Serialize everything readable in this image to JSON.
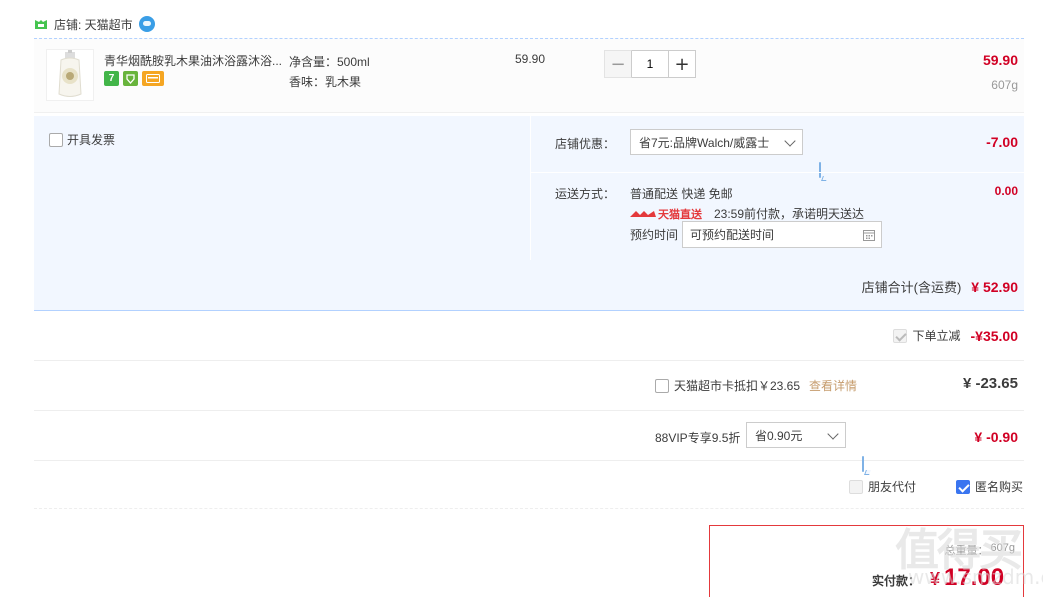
{
  "shop": {
    "label": "店铺: 天猫超市",
    "icon": "tmall-shop-icon"
  },
  "item": {
    "title": "青华烟酰胺乳木果油沐浴露沐浴...",
    "badges": [
      {
        "icon": "seven-day-return-icon",
        "text": "7",
        "color": "#4cb04c"
      },
      {
        "icon": "tmall-guarantee-icon",
        "text": "",
        "color": "#64b23c"
      },
      {
        "icon": "credit-card-icon",
        "text": "",
        "color": "#f5a623"
      }
    ],
    "sku_line1": "净含量：500ml",
    "sku_line2": "香味：乳木果",
    "unit_price": "59.90",
    "quantity": "1",
    "subtotal": "59.90",
    "weight": "607g"
  },
  "options": {
    "invoice_label": "开具发票",
    "shop_discount_label": "店铺优惠：",
    "shop_discount_select": "省7元:品牌Walch/威露士",
    "shop_discount_amount": "-7.00",
    "shipping_label": "运送方式：",
    "shipping_method": "普通配送 快递 免邮",
    "shipping_fee": "0.00",
    "tmall_direct": "天猫直送",
    "delivery_promise": "23:59前付款，承诺明天送达",
    "appointment_label": "预约时间",
    "appointment_placeholder": "可预约配送时间"
  },
  "totals": {
    "shop_total_label": "店铺合计(含运费)",
    "shop_total": "¥ 52.90",
    "instant_discount_label": "下单立减",
    "instant_discount": "-¥35.00",
    "card_label": "天猫超市卡抵扣￥23.65",
    "card_link": "查看详情",
    "card_amount": "¥ -23.65",
    "vip_label": "88VIP专享9.5折",
    "vip_select": "省0.90元",
    "vip_amount": "¥ -0.90",
    "friend_pay_label": "朋友代付",
    "anonymous_label": "匿名购买"
  },
  "pay": {
    "weight_label": "总重量：",
    "weight_value": "607g",
    "actual_label": "实付款：",
    "currency": "¥",
    "amount": "17.00"
  },
  "watermark": {
    "text": "值得买",
    "url": "www.smzdm.com"
  }
}
